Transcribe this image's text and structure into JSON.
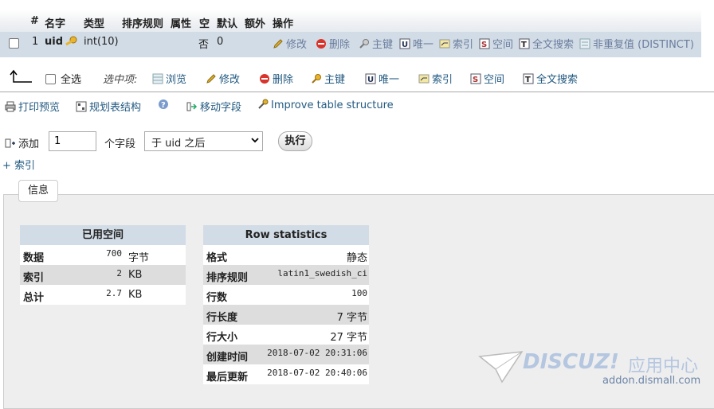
{
  "columns": {
    "num": "#",
    "name": "名字",
    "type": "类型",
    "collation": "排序规则",
    "attributes": "属性",
    "null": "空",
    "default": "默认",
    "extra": "额外",
    "action": "操作"
  },
  "row": {
    "num": "1",
    "name": "uid",
    "type": "int(10)",
    "null": "否",
    "default": "0",
    "actions": [
      "修改",
      "删除",
      "主键",
      "唯一",
      "索引",
      "空间",
      "全文搜索",
      "非重复值 (DISTINCT)"
    ]
  },
  "selection": {
    "check_all": "全选",
    "with_selected": "选中项:",
    "items": [
      "浏览",
      "修改",
      "删除",
      "主键",
      "唯一",
      "索引",
      "空间",
      "全文搜索"
    ]
  },
  "links": [
    "打印预览",
    "规划表结构",
    "移动字段",
    "Improve table structure"
  ],
  "add": {
    "label": "添加",
    "value": "1",
    "field_label": "个字段",
    "position": "于 uid 之后",
    "go": "执行"
  },
  "index_link": "+ 索引",
  "info_tab": "信息",
  "space_usage": {
    "title": "已用空间",
    "rows": [
      {
        "k": "数据",
        "v": "700",
        "u": "字节"
      },
      {
        "k": "索引",
        "v": "2",
        "u": "KB"
      },
      {
        "k": "总计",
        "v": "2.7",
        "u": "KB"
      }
    ]
  },
  "row_stats": {
    "title": "Row statistics",
    "rows": [
      {
        "k": "格式",
        "v": "静态"
      },
      {
        "k": "排序规则",
        "v": "latin1_swedish_ci"
      },
      {
        "k": "行数",
        "v": "100"
      },
      {
        "k": "行长度",
        "v": "7 字节"
      },
      {
        "k": "行大小",
        "v": "27 字节"
      },
      {
        "k": "创建时间",
        "v": "2018-07-02 20:31:06"
      },
      {
        "k": "最后更新",
        "v": "2018-07-02 20:40:06"
      }
    ]
  },
  "watermark": {
    "brand": "DISCUZ!",
    "suffix": "应用中心",
    "url": "addon.dismall.com"
  }
}
